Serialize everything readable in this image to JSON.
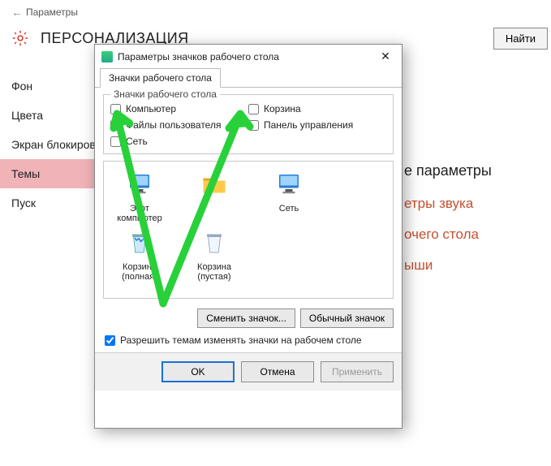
{
  "titlebar": {
    "label": "Параметры"
  },
  "header": {
    "title": "ПЕРСОНАЛИЗАЦИЯ"
  },
  "find_button": "Найти",
  "sidebar": {
    "items": [
      {
        "label": "Фон"
      },
      {
        "label": "Цвета"
      },
      {
        "label": "Экран блокировки"
      },
      {
        "label": "Темы"
      },
      {
        "label": "Пуск"
      }
    ],
    "active_index": 3
  },
  "right_panel": {
    "heading": "е параметры",
    "links": [
      "етры звука",
      "очего стола",
      "ыши"
    ]
  },
  "dialog": {
    "title": "Параметры значков рабочего стола",
    "tab": "Значки рабочего стола",
    "group_legend": "Значки рабочего стола",
    "checks": {
      "computer": "Компьютер",
      "recycle": "Корзина",
      "userfiles": "Файлы пользователя",
      "control": "Панель управления",
      "network": "Сеть"
    },
    "icons": [
      {
        "name": "Этот компьютер",
        "kind": "pc"
      },
      {
        "name": "",
        "kind": "folder"
      },
      {
        "name": "Сеть",
        "kind": "pc"
      },
      {
        "name": "Корзина (полная)",
        "kind": "bin-full"
      },
      {
        "name": "Корзина (пустая)",
        "kind": "bin-empty"
      }
    ],
    "change_icon": "Сменить значок...",
    "default_icon": "Обычный значок",
    "allow_themes": "Разрешить темам изменять значки на рабочем столе",
    "ok": "OK",
    "cancel": "Отмена",
    "apply": "Применить"
  }
}
